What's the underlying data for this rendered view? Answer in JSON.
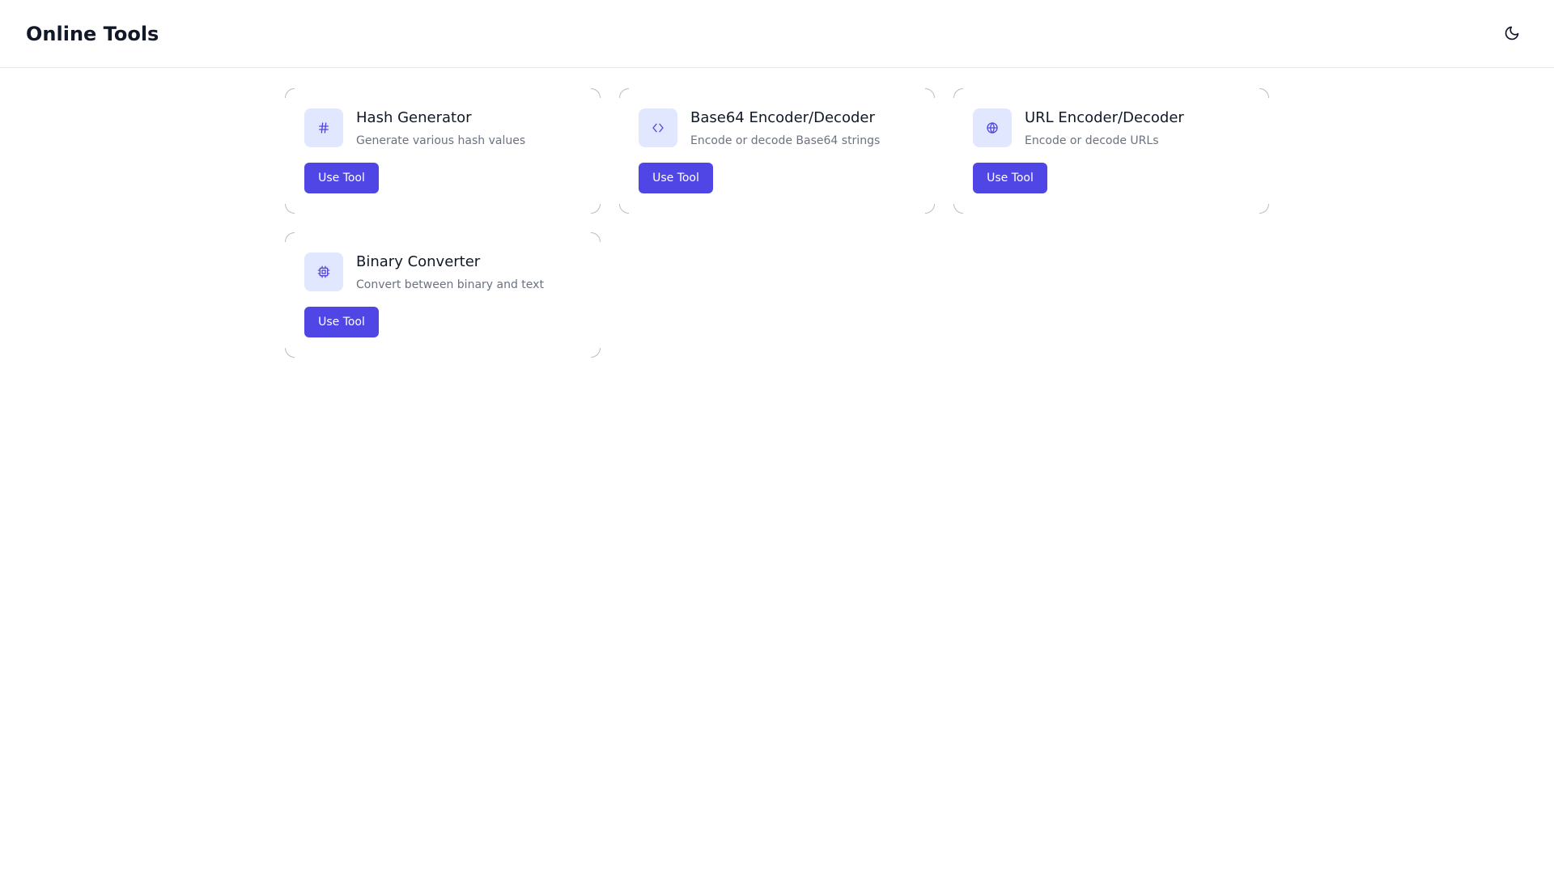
{
  "header": {
    "title": "Online Tools",
    "theme_toggle_icon": "moon-icon"
  },
  "tools": [
    {
      "title": "Hash Generator",
      "description": "Generate various hash values",
      "icon": "hash-icon",
      "button_label": "Use Tool"
    },
    {
      "title": "Base64 Encoder/Decoder",
      "description": "Encode or decode Base64 strings",
      "icon": "code-icon",
      "button_label": "Use Tool"
    },
    {
      "title": "URL Encoder/Decoder",
      "description": "Encode or decode URLs",
      "icon": "globe-icon",
      "button_label": "Use Tool"
    },
    {
      "title": "Binary Converter",
      "description": "Convert between binary and text",
      "icon": "cpu-icon",
      "button_label": "Use Tool"
    }
  ],
  "colors": {
    "accent": "#4f46e5",
    "icon_bg": "#e0e7ff",
    "border": "#e5e7eb"
  }
}
